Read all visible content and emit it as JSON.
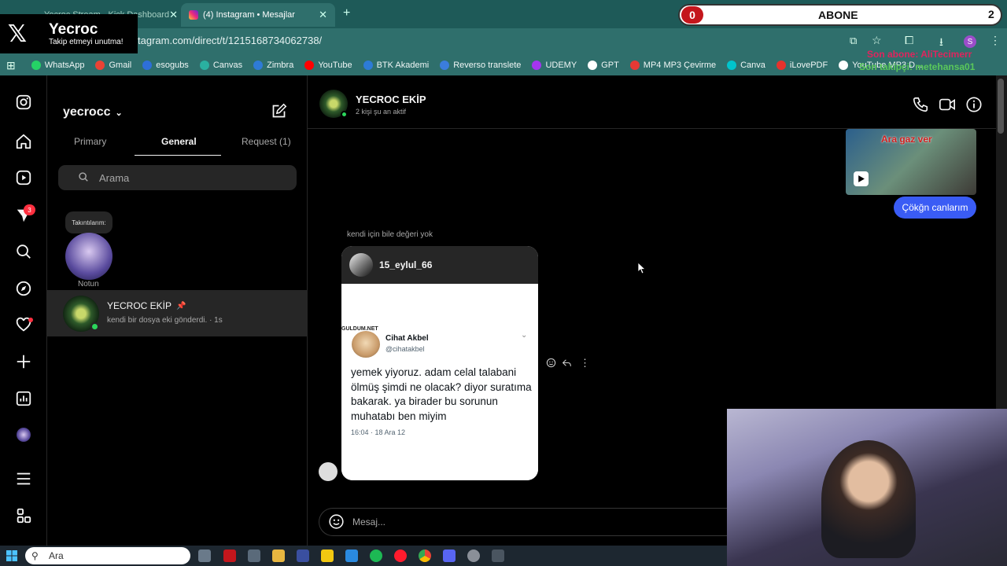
{
  "browser": {
    "tabs": [
      {
        "label": "Yecroc Stream - Kick Dashboard"
      },
      {
        "label": "(4) Instagram • Mesajlar"
      }
    ],
    "url": "tagram.com/direct/t/1215168734062738/",
    "bookmarks": [
      {
        "label": "WhatsApp",
        "color": "#25d366"
      },
      {
        "label": "Gmail",
        "color": "#ea4335"
      },
      {
        "label": "esogubs",
        "color": "#2e6fd8"
      },
      {
        "label": "Canvas",
        "color": "#2ab0a0"
      },
      {
        "label": "Zimbra",
        "color": "#2e7bd6"
      },
      {
        "label": "YouTube",
        "color": "#ff0000"
      },
      {
        "label": "BTK Akademi",
        "color": "#2d7bd6"
      },
      {
        "label": "Reverso translete",
        "color": "#3b7ddd"
      },
      {
        "label": "UDEMY",
        "color": "#a435f0"
      },
      {
        "label": "GPT",
        "color": "#ffffff"
      },
      {
        "label": "MP4 MP3 Çevirme",
        "color": "#e53935"
      },
      {
        "label": "Canva",
        "color": "#00c4cc"
      },
      {
        "label": "iLovePDF",
        "color": "#e5322d"
      },
      {
        "label": "YouTube MP3 D...",
        "color": "#ffffff"
      }
    ]
  },
  "overlay": {
    "channel_name": "Yecroc",
    "channel_sub": "Takip etmeyi unutma!",
    "abone_count": "0",
    "abone_label": "ABONE",
    "abone_goal": "2",
    "last_sub": "Son abone: AliTecimerr",
    "last_follower": "Son takipçi: metehansa01"
  },
  "instagram": {
    "account": "yecrocc",
    "nav_badge": "3",
    "tabs": {
      "primary": "Primary",
      "general": "General",
      "request": "Request (1)"
    },
    "search_placeholder": "Arama",
    "note": {
      "bubble": "Takıntılarım:",
      "label": "Notun"
    },
    "conversation": {
      "name": "YECROC EKİP",
      "preview": "kendi bir dosya eki gönderdi. · 1s"
    },
    "chat": {
      "title": "YECROC EKİP",
      "subtitle": "2 kişi şu an aktif",
      "video_caption": "Ara gaz ver",
      "sent_bubble": "Çökğn canlarım",
      "reply_label": "kendi için bile değeri yok",
      "shared_post": {
        "user": "15_eylul_66",
        "watermark": "GULDUM.NET",
        "tweet_name": "Cihat Akbel",
        "tweet_handle": "@cihatakbel",
        "tweet_text": "yemek yiyoruz. adam celal talabani ölmüş şimdi ne olacak? diyor suratıma bakarak. ya birader bu sorunun muhatabı ben miyim",
        "tweet_time": "16:04 · 18 Ara 12"
      },
      "message_placeholder": "Mesaj..."
    }
  },
  "taskbar": {
    "search_label": "Ara"
  }
}
